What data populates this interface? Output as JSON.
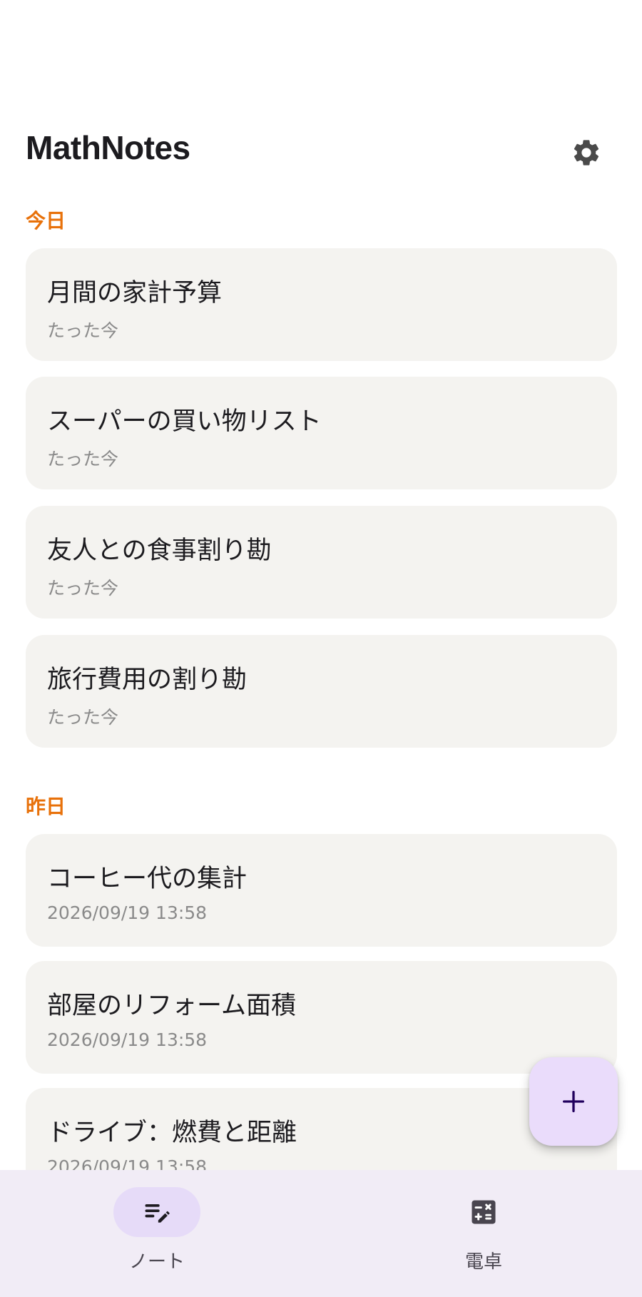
{
  "app": {
    "title": "MathNotes"
  },
  "sections": [
    {
      "label": "今日",
      "notes": [
        {
          "title": "月間の家計予算",
          "time": "たった今"
        },
        {
          "title": "スーパーの買い物リスト",
          "time": "たった今"
        },
        {
          "title": "友人との食事割り勘",
          "time": "たった今"
        },
        {
          "title": "旅行費用の割り勘",
          "time": "たった今"
        }
      ]
    },
    {
      "label": "昨日",
      "notes": [
        {
          "title": "コーヒー代の集計",
          "time": "2026/09/19 13:58"
        },
        {
          "title": "部屋のリフォーム面積",
          "time": "2026/09/19 13:58"
        },
        {
          "title": "ドライブ：燃費と距離",
          "time": "2026/09/19 13:58"
        }
      ]
    }
  ],
  "nav": {
    "notes_label": "ノート",
    "calc_label": "電卓",
    "active": "notes"
  },
  "icons": {
    "settings": "gear-icon",
    "add": "plus-icon",
    "notes": "notes-edit-icon",
    "calculator": "calculator-icon"
  },
  "colors": {
    "section_accent": "#e8710a",
    "card_background": "#f4f3f0",
    "fab_background": "#eadcfb",
    "nav_background": "#f1ecf6",
    "nav_active_pill": "#e6dbf8"
  }
}
